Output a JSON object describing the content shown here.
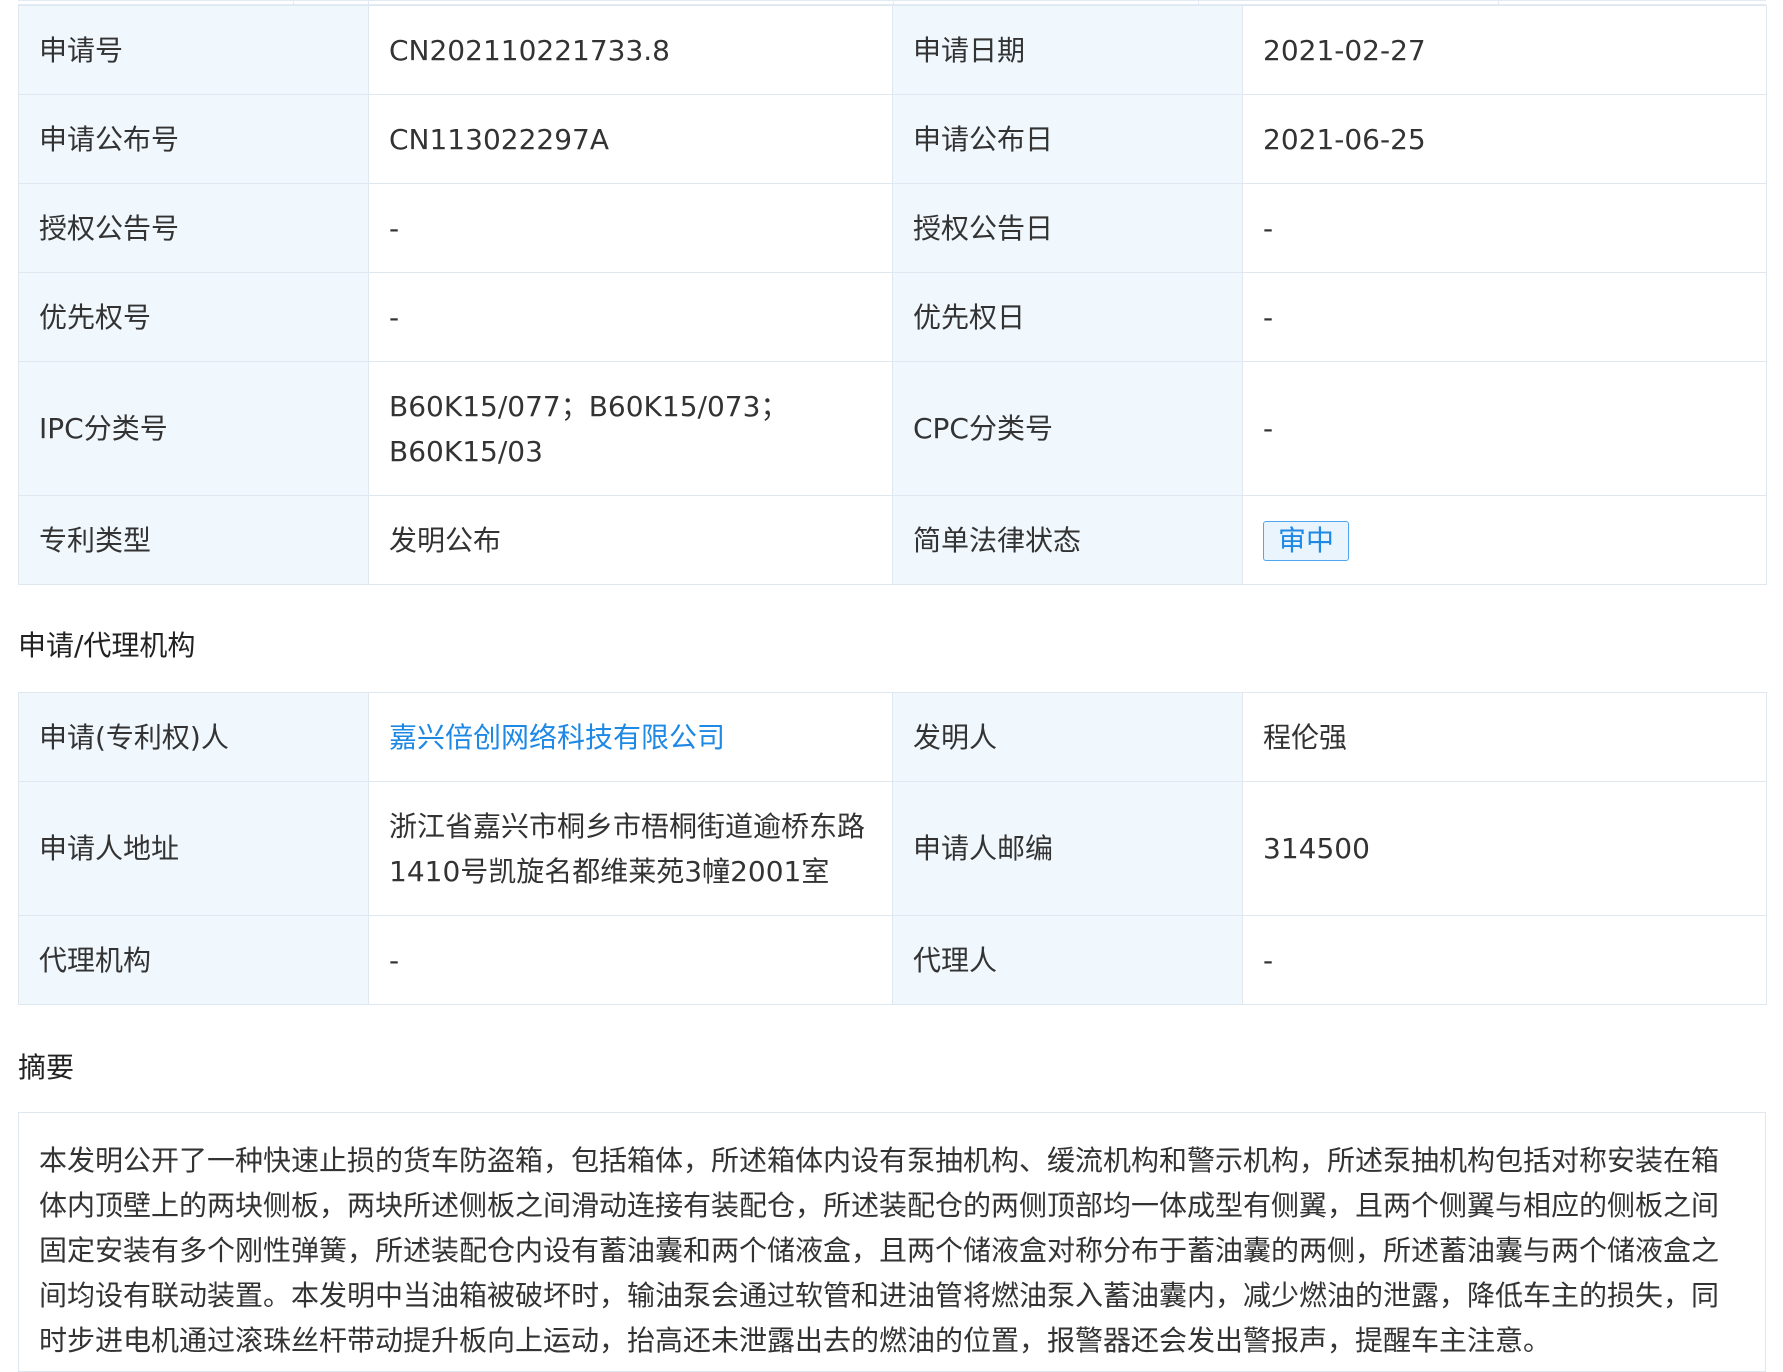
{
  "basic_info": {
    "rows": [
      {
        "label1": "申请号",
        "value1": "CN202110221733.8",
        "label2": "申请日期",
        "value2": "2021-02-27"
      },
      {
        "label1": "申请公布号",
        "value1": "CN113022297A",
        "label2": "申请公布日",
        "value2": "2021-06-25"
      },
      {
        "label1": "授权公告号",
        "value1": "-",
        "label2": "授权公告日",
        "value2": "-"
      },
      {
        "label1": "优先权号",
        "value1": "-",
        "label2": "优先权日",
        "value2": "-"
      },
      {
        "label1": "IPC分类号",
        "value1": "B60K15/077；B60K15/073；B60K15/03",
        "label2": "CPC分类号",
        "value2": "-"
      },
      {
        "label1": "专利类型",
        "value1": "发明公布",
        "label2": "简单法律状态",
        "value2": "审中"
      }
    ]
  },
  "agency_section": {
    "heading": "申请/代理机构",
    "rows": [
      {
        "label1": "申请(专利权)人",
        "value1": "嘉兴倍创网络科技有限公司",
        "label2": "发明人",
        "value2": "程伦强"
      },
      {
        "label1": "申请人地址",
        "value1": "浙江省嘉兴市桐乡市梧桐街道逾桥东路1410号凯旋名都维莱苑3幢2001室",
        "label2": "申请人邮编",
        "value2": "314500"
      },
      {
        "label1": "代理机构",
        "value1": "-",
        "label2": "代理人",
        "value2": "-"
      }
    ]
  },
  "abstract_section": {
    "heading": "摘要",
    "text": "本发明公开了一种快速止损的货车防盗箱，包括箱体，所述箱体内设有泵抽机构、缓流机构和警示机构，所述泵抽机构包括对称安装在箱体内顶壁上的两块侧板，两块所述侧板之间滑动连接有装配仓，所述装配仓的两侧顶部均一体成型有侧翼，且两个侧翼与相应的侧板之间固定安装有多个刚性弹簧，所述装配仓内设有蓄油囊和两个储液盒，且两个储液盒对称分布于蓄油囊的两侧，所述蓄油囊与两个储液盒之间均设有联动装置。本发明中当油箱被破坏时，输油泵会通过软管和进油管将燃油泵入蓄油囊内，减少燃油的泄露，降低车主的损失，同时步进电机通过滚珠丝杆带动提升板向上运动，抬高还未泄露出去的燃油的位置，报警器还会发出警报声，提醒车主注意。"
  },
  "colors": {
    "label_bg": "#f0f7fd",
    "border": "#dfe7f0",
    "link": "#1e88e5",
    "badge_border": "#4ea5f0"
  }
}
